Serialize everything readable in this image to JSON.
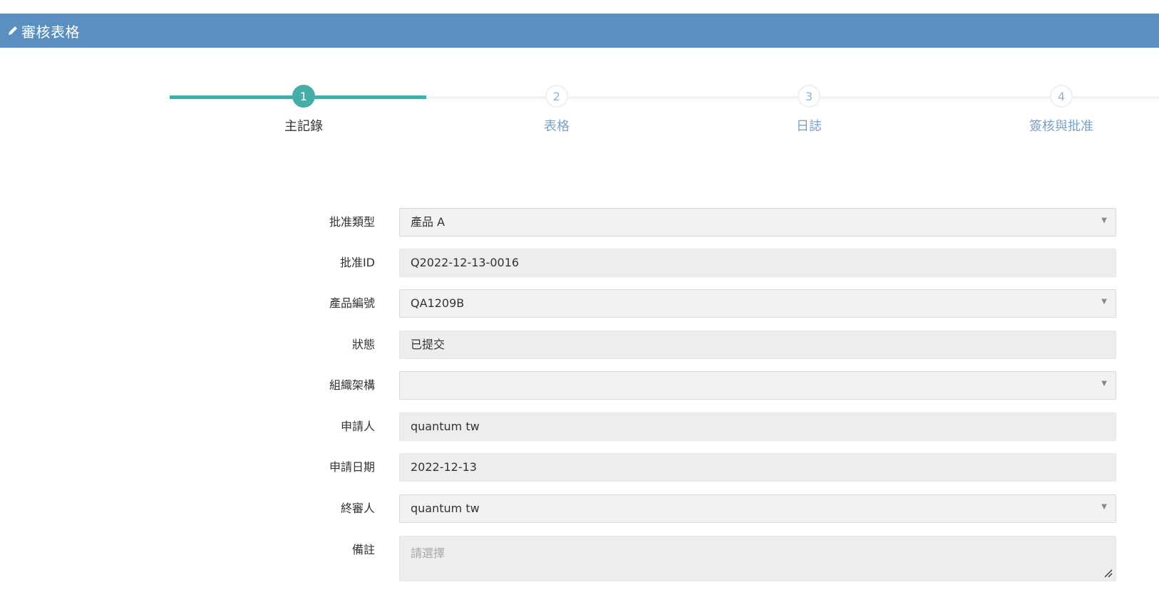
{
  "header": {
    "title": "審核表格",
    "icon": "pencil-icon",
    "bg_color": "#5a8fbf"
  },
  "wizard": {
    "accent_color": "#45aea8",
    "current_step": 1,
    "steps": [
      {
        "number": "1",
        "label": "主記錄"
      },
      {
        "number": "2",
        "label": "表格"
      },
      {
        "number": "3",
        "label": "日誌"
      },
      {
        "number": "4",
        "label": "簽核與批准"
      }
    ]
  },
  "form": {
    "approval_type": {
      "label": "批准類型",
      "value": "產品 A"
    },
    "approval_id": {
      "label": "批准ID",
      "value": "Q2022-12-13-0016"
    },
    "product_number": {
      "label": "產品編號",
      "value": "QA1209B"
    },
    "status": {
      "label": "狀態",
      "value": "已提交"
    },
    "organization": {
      "label": "組織架構",
      "value": ""
    },
    "applicant": {
      "label": "申請人",
      "value": "quantum tw"
    },
    "apply_date": {
      "label": "申請日期",
      "value": "2022-12-13"
    },
    "final_reviewer": {
      "label": "終審人",
      "value": "quantum tw"
    },
    "remarks": {
      "label": "備註",
      "placeholder": "請選擇"
    }
  }
}
